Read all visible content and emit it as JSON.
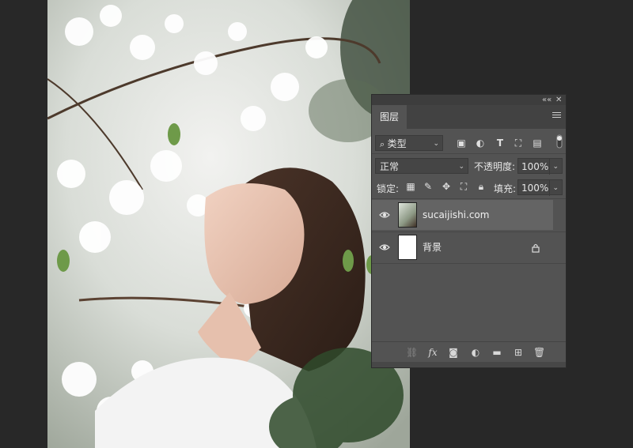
{
  "panel": {
    "tab_label": "图层",
    "filter": {
      "value": "类型"
    },
    "blend_mode": {
      "value": "正常"
    },
    "opacity": {
      "label": "不透明度:",
      "value": "100%"
    },
    "lock": {
      "label": "锁定:"
    },
    "fill": {
      "label": "填充:",
      "value": "100%"
    },
    "layers": [
      {
        "name": "sucaijishi.com",
        "selected": true,
        "locked": false
      },
      {
        "name": "背景",
        "selected": false,
        "locked": true
      }
    ]
  },
  "colors": {
    "panel_bg": "#535353",
    "selected_layer": "#646464",
    "app_bg": "#282828"
  }
}
